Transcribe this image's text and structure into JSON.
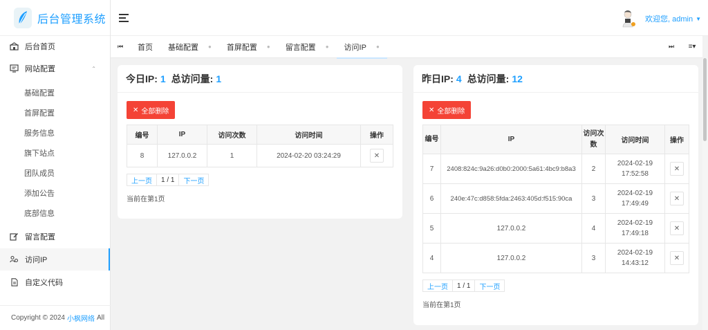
{
  "app": {
    "title": "后台管理系统"
  },
  "sidebar": {
    "items": [
      {
        "label": "后台首页",
        "icon": "home-icon"
      },
      {
        "label": "网站配置",
        "icon": "monitor-icon",
        "expanded": true,
        "children": [
          "基础配置",
          "首屏配置",
          "服务信息",
          "旗下站点",
          "团队成员",
          "添加公告",
          "底部信息"
        ]
      },
      {
        "label": "留言配置",
        "icon": "edit-icon"
      },
      {
        "label": "访问IP",
        "icon": "users-icon",
        "active": true
      },
      {
        "label": "自定义代码",
        "icon": "file-icon"
      }
    ],
    "copyright_prefix": "Copyright © 2024",
    "copyright_link": "小枫网络",
    "copyright_suffix": "All"
  },
  "header": {
    "welcome": "欢迎您, admin"
  },
  "tabs": [
    {
      "label": "首页",
      "closable": false
    },
    {
      "label": "基础配置",
      "closable": true
    },
    {
      "label": "首屏配置",
      "closable": true
    },
    {
      "label": "留言配置",
      "closable": true
    },
    {
      "label": "访问IP",
      "closable": true,
      "active": true
    }
  ],
  "today": {
    "ip_label": "今日IP:",
    "ip_count": "1",
    "total_label": "总访问量:",
    "total_count": "1",
    "delete_all": "全部删除",
    "columns": [
      "编号",
      "IP",
      "访问次数",
      "访问时间",
      "操作"
    ],
    "rows": [
      {
        "id": "8",
        "ip": "127.0.0.2",
        "count": "1",
        "time": "2024-02-20 03:24:29"
      }
    ],
    "pager": {
      "prev": "上一页",
      "current": "1 / 1",
      "next": "下一页"
    },
    "page_note": "当前在第1页"
  },
  "yesterday": {
    "ip_label": "昨日IP:",
    "ip_count": "4",
    "total_label": "总访问量:",
    "total_count": "12",
    "delete_all": "全部删除",
    "columns": [
      "编号",
      "IP",
      "访问次数",
      "访问时间",
      "操作"
    ],
    "rows": [
      {
        "id": "7",
        "ip": "2408:824c:9a26:d0b0:2000:5a61:4bc9:b8a3",
        "count": "2",
        "date": "2024-02-19",
        "clock": "17:52:58"
      },
      {
        "id": "6",
        "ip": "240e:47c:d858:5fda:2463:405d:f515:90ca",
        "count": "3",
        "date": "2024-02-19",
        "clock": "17:49:49"
      },
      {
        "id": "5",
        "ip": "127.0.0.2",
        "count": "4",
        "date": "2024-02-19",
        "clock": "17:49:18"
      },
      {
        "id": "4",
        "ip": "127.0.0.2",
        "count": "3",
        "date": "2024-02-19",
        "clock": "14:43:12"
      }
    ],
    "pager": {
      "prev": "上一页",
      "current": "1 / 1",
      "next": "下一页"
    },
    "page_note": "当前在第1页"
  },
  "colors": {
    "accent": "#1e9fff",
    "danger": "#f44336"
  }
}
